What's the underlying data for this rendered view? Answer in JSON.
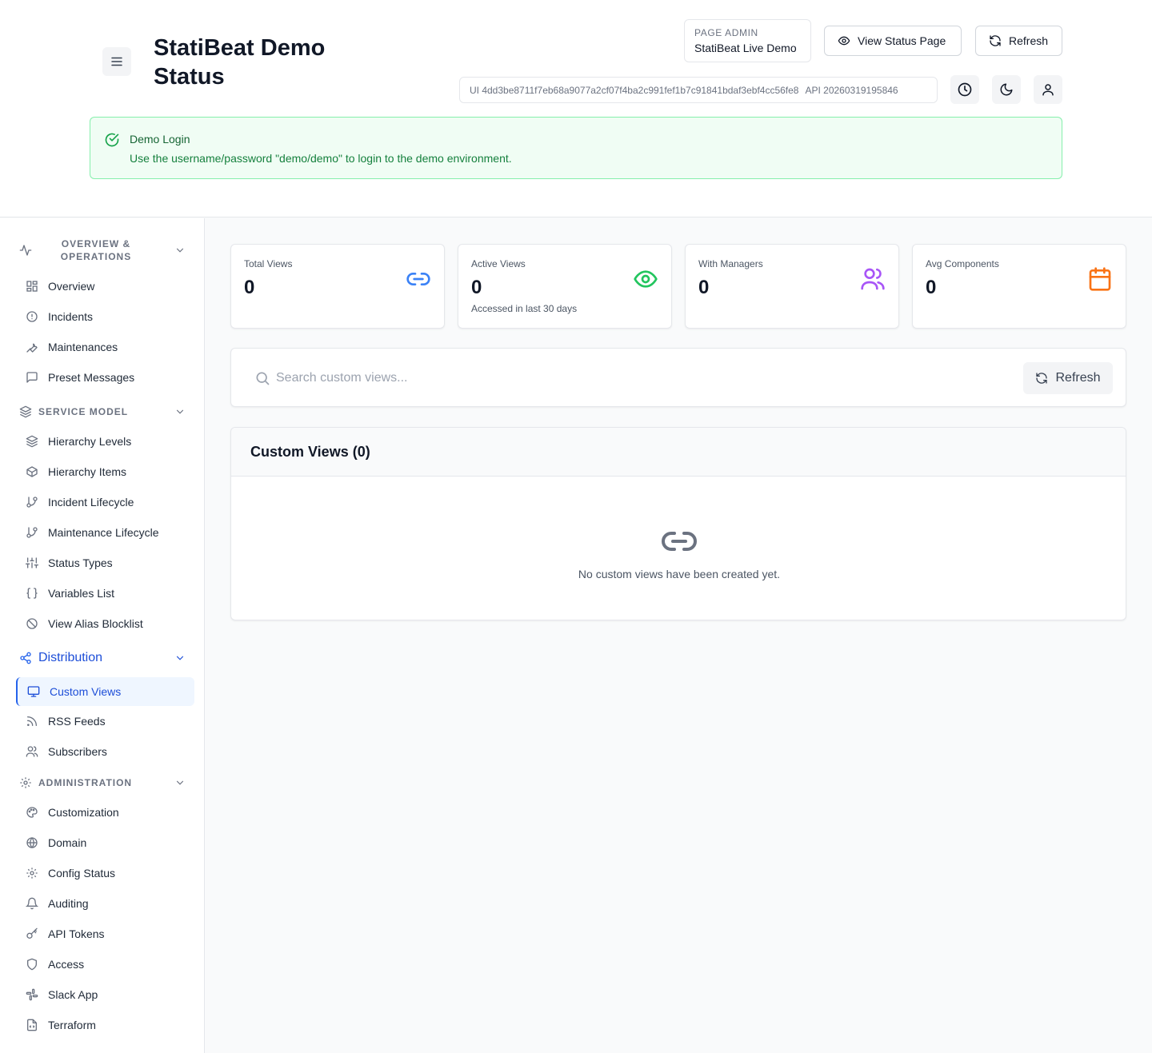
{
  "header": {
    "title": "StatiBeat Demo Status",
    "page_admin_label": "PAGE ADMIN",
    "page_admin_value": "StatiBeat Live Demo",
    "view_status_label": "View Status Page",
    "refresh_label": "Refresh",
    "ui_version": "UI 4dd3be8711f7eb68a9077a2cf07f4ba2c991fef1b7c91841bdaf3ebf4cc56fe8",
    "api_version": "API 20260319195846"
  },
  "notice": {
    "title": "Demo Login",
    "text": "Use the username/password \"demo/demo\" to login to the demo environment."
  },
  "sidebar": {
    "sections": [
      {
        "label": "OVERVIEW & OPERATIONS",
        "items": [
          "Overview",
          "Incidents",
          "Maintenances",
          "Preset Messages"
        ]
      },
      {
        "label": "SERVICE MODEL",
        "items": [
          "Hierarchy Levels",
          "Hierarchy Items",
          "Incident Lifecycle",
          "Maintenance Lifecycle",
          "Status Types",
          "Variables List",
          "View Alias Blocklist"
        ]
      },
      {
        "label": "Distribution",
        "items": [
          "Custom Views",
          "RSS Feeds",
          "Subscribers"
        ]
      },
      {
        "label": "ADMINISTRATION",
        "items": [
          "Customization",
          "Domain",
          "Config Status",
          "Auditing",
          "API Tokens",
          "Access",
          "Slack App",
          "Terraform"
        ]
      }
    ]
  },
  "stats": [
    {
      "label": "Total Views",
      "value": "0",
      "sub": "",
      "icon": "link-icon",
      "color": "#3b82f6"
    },
    {
      "label": "Active Views",
      "value": "0",
      "sub": "Accessed in last 30 days",
      "icon": "eye-icon",
      "color": "#22c55e"
    },
    {
      "label": "With Managers",
      "value": "0",
      "sub": "",
      "icon": "users-icon",
      "color": "#a855f7"
    },
    {
      "label": "Avg Components",
      "value": "0",
      "sub": "",
      "icon": "calendar-icon",
      "color": "#f97316"
    }
  ],
  "search": {
    "placeholder": "Search custom views...",
    "refresh_label": "Refresh"
  },
  "custom_views": {
    "title": "Custom Views (0)",
    "empty_text": "No custom views have been created yet."
  },
  "colors": {
    "accent": "#2563eb",
    "active_bg": "#eff6ff",
    "notice_bg": "#f0fdf4",
    "notice_border": "#86efac"
  }
}
